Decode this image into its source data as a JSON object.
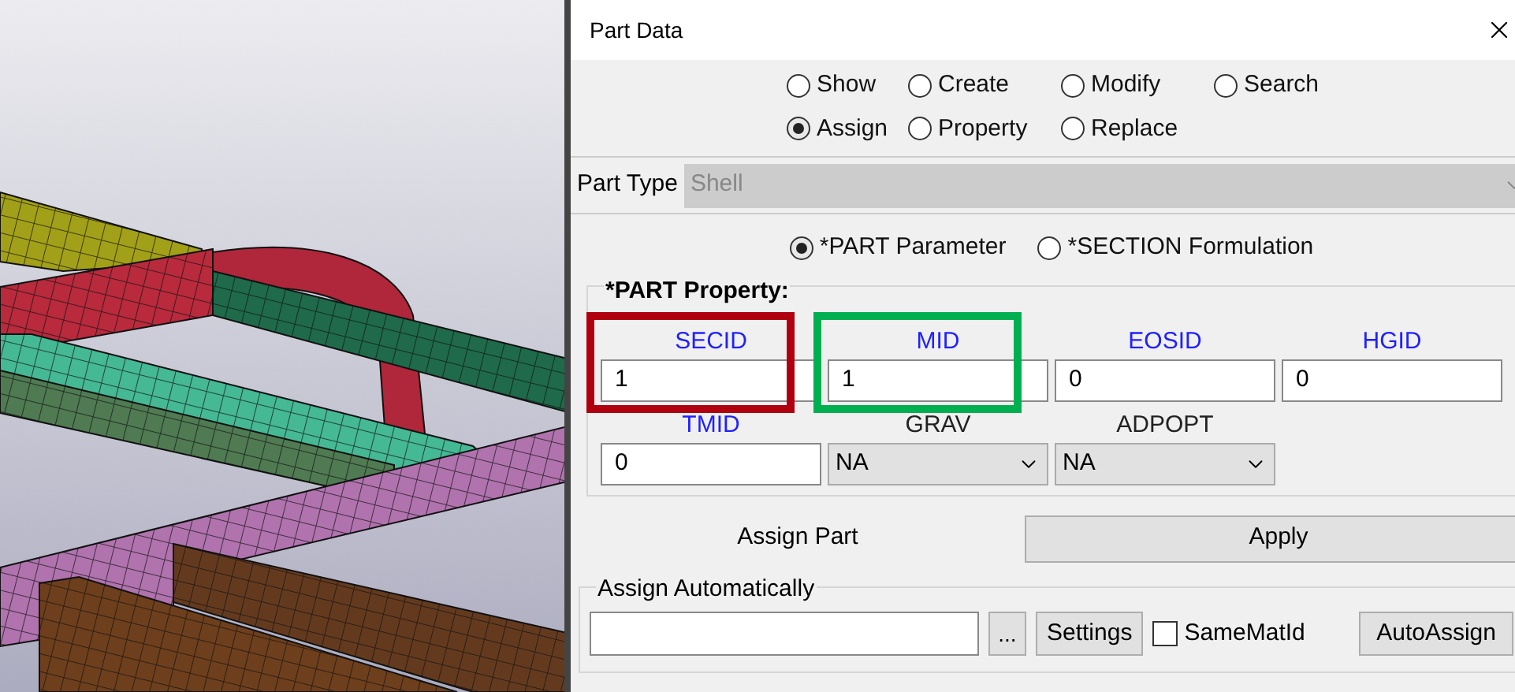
{
  "window": {
    "title": "Part Data"
  },
  "modes": [
    [
      {
        "label": "Show",
        "selected": false
      },
      {
        "label": "Create",
        "selected": false
      },
      {
        "label": "Modify",
        "selected": false
      },
      {
        "label": "Search",
        "selected": false
      }
    ],
    [
      {
        "label": "Assign",
        "selected": true
      },
      {
        "label": "Property",
        "selected": false
      },
      {
        "label": "Replace",
        "selected": false
      }
    ]
  ],
  "part_type": {
    "label": "Part Type",
    "value": "Shell",
    "disabled": true
  },
  "options": [
    {
      "label": "*PART Parameter",
      "selected": true
    },
    {
      "label": "*SECTION Formulation",
      "selected": false
    }
  ],
  "property": {
    "title": "*PART Property:",
    "fields": [
      {
        "kind": "input",
        "label": "SECID",
        "value": "1",
        "color": "#b00010"
      },
      {
        "kind": "input",
        "label": "MID",
        "value": "1",
        "color": "#00b050"
      },
      {
        "kind": "input",
        "label": "EOSID",
        "value": "0"
      },
      {
        "kind": "input",
        "label": "HGID",
        "value": "0"
      },
      {
        "kind": "input",
        "label": "TMID",
        "value": "0"
      },
      {
        "kind": "select",
        "label": "GRAV",
        "value": "NA"
      },
      {
        "kind": "select",
        "label": "ADPOPT",
        "value": "NA"
      }
    ]
  },
  "assign_part": {
    "label": "Assign Part",
    "button": "Apply"
  },
  "auto": {
    "title": "Assign Automatically",
    "browse": "...",
    "settings": "Settings",
    "same_mat_id": {
      "label": "SameMatId",
      "checked": false
    },
    "button": "AutoAssign"
  }
}
